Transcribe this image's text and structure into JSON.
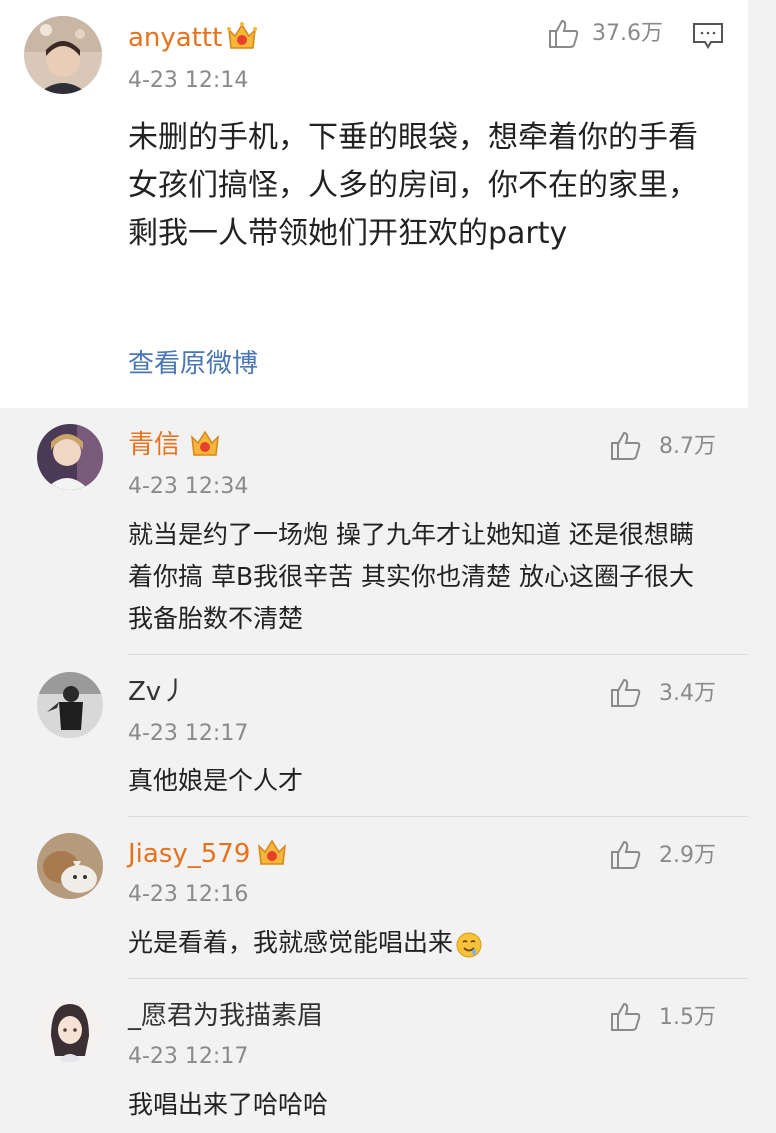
{
  "main_post": {
    "username": "anyattt",
    "timestamp": "4-23 12:14",
    "likes": "37.6万",
    "text": "未删的手机，下垂的眼袋，想牵着你的手看女孩们搞怪，人多的房间，你不在的家里，剩我一人带领她们开狂欢的party",
    "view_original": "查看原微博"
  },
  "replies": [
    {
      "username": "青信",
      "timestamp": "4-23 12:34",
      "likes": "8.7万",
      "text": "就当是约了一场炮 操了九年才让她知道 还是很想瞒着你搞 草B我很辛苦 其实你也清楚 放心这圈子很大 我备胎数不清楚"
    },
    {
      "username": "Zv丿",
      "timestamp": "4-23 12:17",
      "likes": "3.4万",
      "text": "真他娘是个人才"
    },
    {
      "username": "Jiasy_579",
      "timestamp": "4-23 12:16",
      "likes": "2.9万",
      "text": "光是看着，我就感觉能唱出来"
    },
    {
      "username": "_愿君为我描素眉",
      "timestamp": "4-23 12:17",
      "likes": "1.5万",
      "text": "我唱出来了哈哈哈"
    }
  ],
  "colors": {
    "vip_name": "#e8711c",
    "link": "#4a77b4",
    "meta": "#8a8a8a",
    "background": "#f2f2f2"
  },
  "icons": [
    "vip-crown-icon",
    "thumbs-up-icon",
    "comment-icon",
    "drooling-face-emoji-icon"
  ]
}
